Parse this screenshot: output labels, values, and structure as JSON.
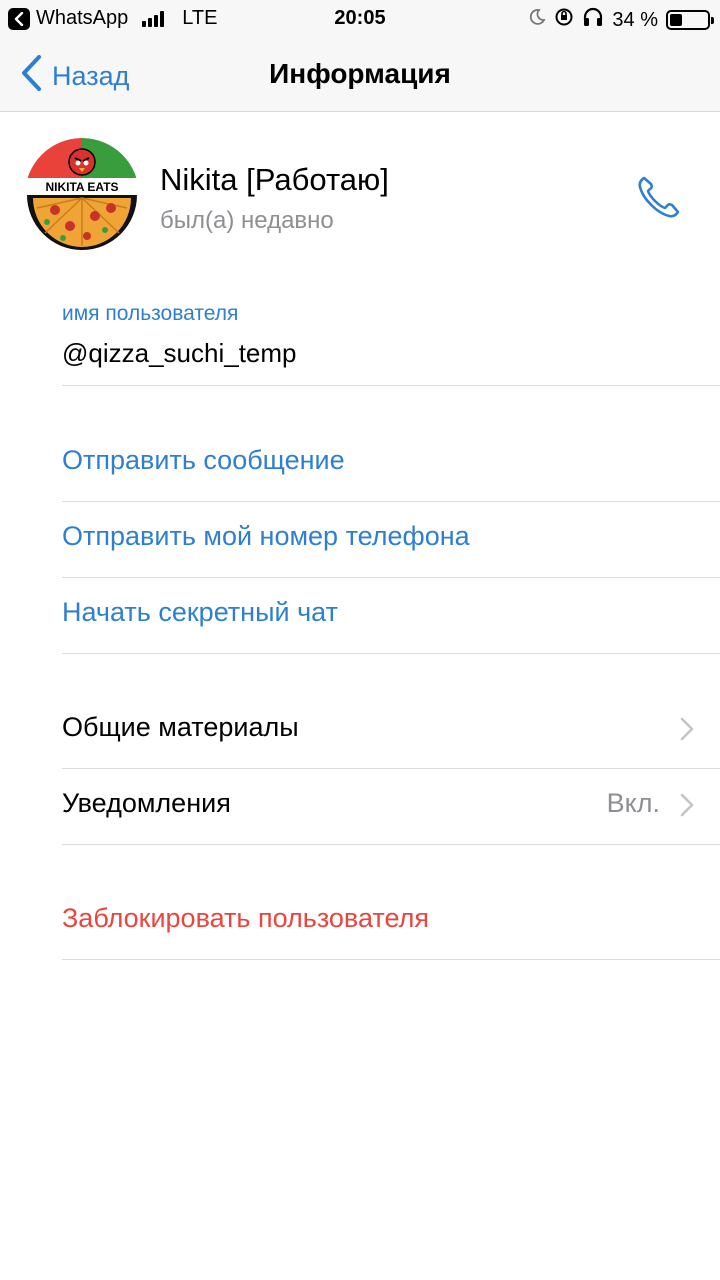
{
  "status_bar": {
    "app_back": "WhatsApp",
    "network": "LTE",
    "time": "20:05",
    "battery": "34 %",
    "battery_level": 0.34
  },
  "nav": {
    "back_label": "Назад",
    "title": "Информация"
  },
  "profile": {
    "name": "Nikita [Работаю]",
    "status": "был(а) недавно",
    "avatar_text": "NIKITA EATS"
  },
  "username": {
    "label": "имя пользователя",
    "value": "@qizza_suchi_temp"
  },
  "actions": {
    "send_message": "Отправить сообщение",
    "send_phone": "Отправить мой номер телефона",
    "secret_chat": "Начать секретный чат"
  },
  "settings": {
    "shared_media": "Общие материалы",
    "notifications": "Уведомления",
    "notifications_value": "Вкл."
  },
  "danger": {
    "block_user": "Заблокировать пользователя"
  },
  "colors": {
    "accent": "#2f7fd1",
    "destructive": "#e9463d",
    "secondary_text": "#8e8e93"
  }
}
